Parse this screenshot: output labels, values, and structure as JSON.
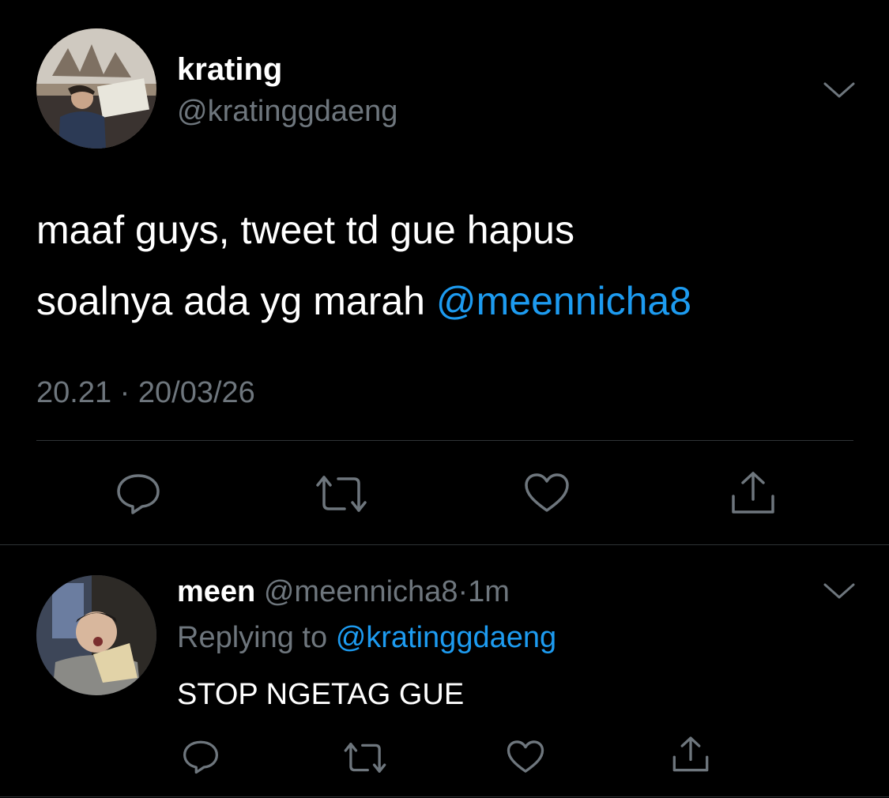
{
  "tweet": {
    "display_name": "krating",
    "handle": "@kratinggdaeng",
    "text_line1": "maaf guys, tweet td gue hapus",
    "text_line2_prefix": "soalnya ada yg marah ",
    "mention": "@meennicha8",
    "time": "20.21",
    "separator": "·",
    "date": "20/03/26",
    "avatar_icon": "profile-photo-museum",
    "actions": [
      "reply-icon",
      "retweet-icon",
      "like-icon",
      "share-icon"
    ]
  },
  "reply": {
    "display_name": "meen",
    "handle": "@meennicha8",
    "separator": "·",
    "age": "1m",
    "replying_label": "Replying to",
    "replying_to": "@kratinggdaeng",
    "text": "STOP NGETAG GUE",
    "avatar_icon": "profile-photo-food",
    "actions": [
      "reply-icon",
      "retweet-icon",
      "like-icon",
      "share-icon"
    ]
  },
  "colors": {
    "background": "#000000",
    "text": "#ffffff",
    "muted": "#6e767d",
    "link": "#1d9bf0",
    "divider": "#2f3336"
  }
}
